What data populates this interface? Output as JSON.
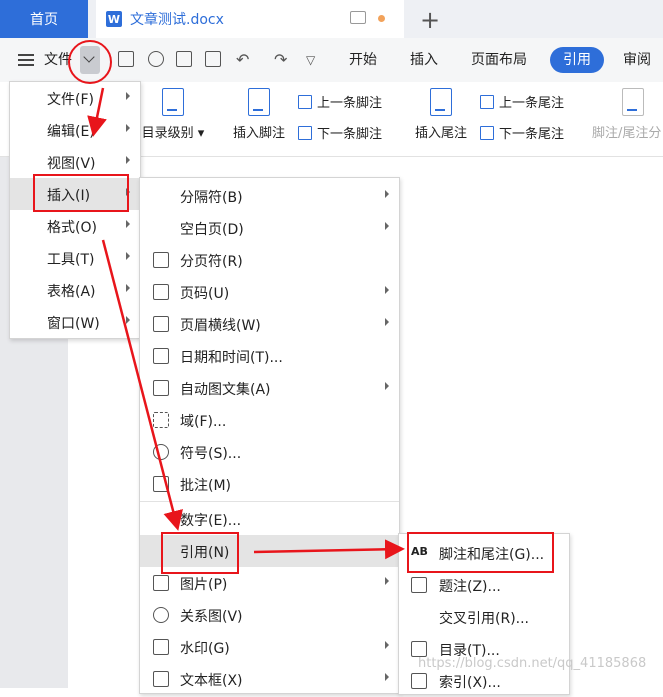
{
  "tabs": {
    "home": "首页",
    "document": "文章测试.docx",
    "doc_icon": "W"
  },
  "toolbar": {
    "file_label": "文件",
    "ribbon_tabs": [
      "开始",
      "插入",
      "页面布局",
      "引用",
      "审阅"
    ]
  },
  "ribbon": {
    "toc_level": "目录级别",
    "insert_footnote": "插入脚注",
    "prev_footnote": "上一条脚注",
    "next_footnote": "下一条脚注",
    "insert_endnote": "插入尾注",
    "prev_endnote": "上一条尾注",
    "next_endnote": "下一条尾注",
    "footnote_endnote_sep": "脚注/尾注分"
  },
  "main_menu": [
    {
      "label": "文件(F)"
    },
    {
      "label": "编辑(E)"
    },
    {
      "label": "视图(V)"
    },
    {
      "label": "插入(I)"
    },
    {
      "label": "格式(O)"
    },
    {
      "label": "工具(T)"
    },
    {
      "label": "表格(A)"
    },
    {
      "label": "窗口(W)"
    }
  ],
  "insert_menu": [
    {
      "label": "分隔符(B)"
    },
    {
      "label": "空白页(D)"
    },
    {
      "label": "分页符(R)"
    },
    {
      "label": "页码(U)"
    },
    {
      "label": "页眉横线(W)"
    },
    {
      "label": "日期和时间(T)..."
    },
    {
      "label": "自动图文集(A)"
    },
    {
      "label": "域(F)..."
    },
    {
      "label": "符号(S)..."
    },
    {
      "label": "批注(M)"
    },
    {
      "label": "数字(E)..."
    },
    {
      "label": "引用(N)"
    },
    {
      "label": "图片(P)"
    },
    {
      "label": "关系图(V)"
    },
    {
      "label": "水印(G)"
    },
    {
      "label": "文本框(X)"
    }
  ],
  "reference_menu": [
    {
      "label": "脚注和尾注(G)..."
    },
    {
      "label": "题注(Z)..."
    },
    {
      "label": "交叉引用(R)..."
    },
    {
      "label": "目录(T)..."
    },
    {
      "label": "索引(X)..."
    }
  ],
  "watermark": "https://blog.csdn.net/qq_41185868",
  "colors": {
    "accent": "#2e6ed9",
    "annotation": "#e8151b"
  }
}
